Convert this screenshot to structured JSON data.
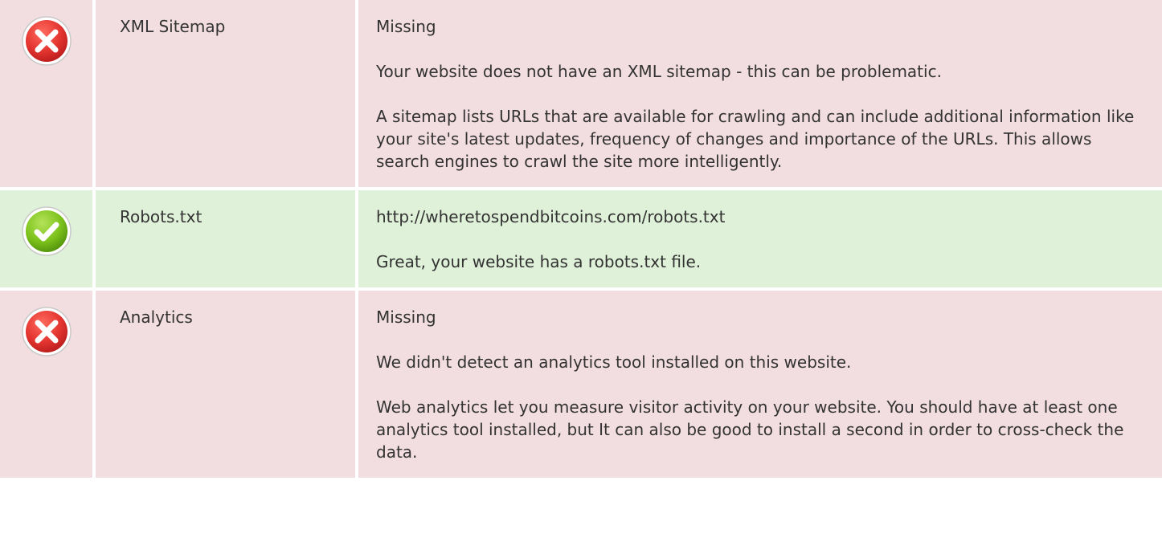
{
  "colors": {
    "fail_bg": "#f2dde0",
    "pass_bg": "#dff1d8",
    "fail_icon": "#e3342f",
    "pass_icon": "#7cc21b"
  },
  "rows": [
    {
      "status": "fail",
      "icon": "error-x-icon",
      "name": "XML Sitemap",
      "value": "Missing",
      "message": "Your website does not have an XML sitemap - this can be problematic.",
      "description": "A sitemap lists URLs that are available for crawling and can include additional information like your site's latest updates, frequency of changes and importance of the URLs. This allows search engines to crawl the site more intelligently."
    },
    {
      "status": "pass",
      "icon": "check-icon",
      "name": "Robots.txt",
      "value": "http://wheretospendbitcoins.com/robots.txt",
      "message": "Great, your website has a robots.txt file."
    },
    {
      "status": "fail",
      "icon": "error-x-icon",
      "name": "Analytics",
      "value": "Missing",
      "message": "We didn't detect an analytics tool installed on this website.",
      "description": "Web analytics let you measure visitor activity on your website. You should have at least one analytics tool installed, but It can also be good to install a second in order to cross-check the data."
    }
  ]
}
